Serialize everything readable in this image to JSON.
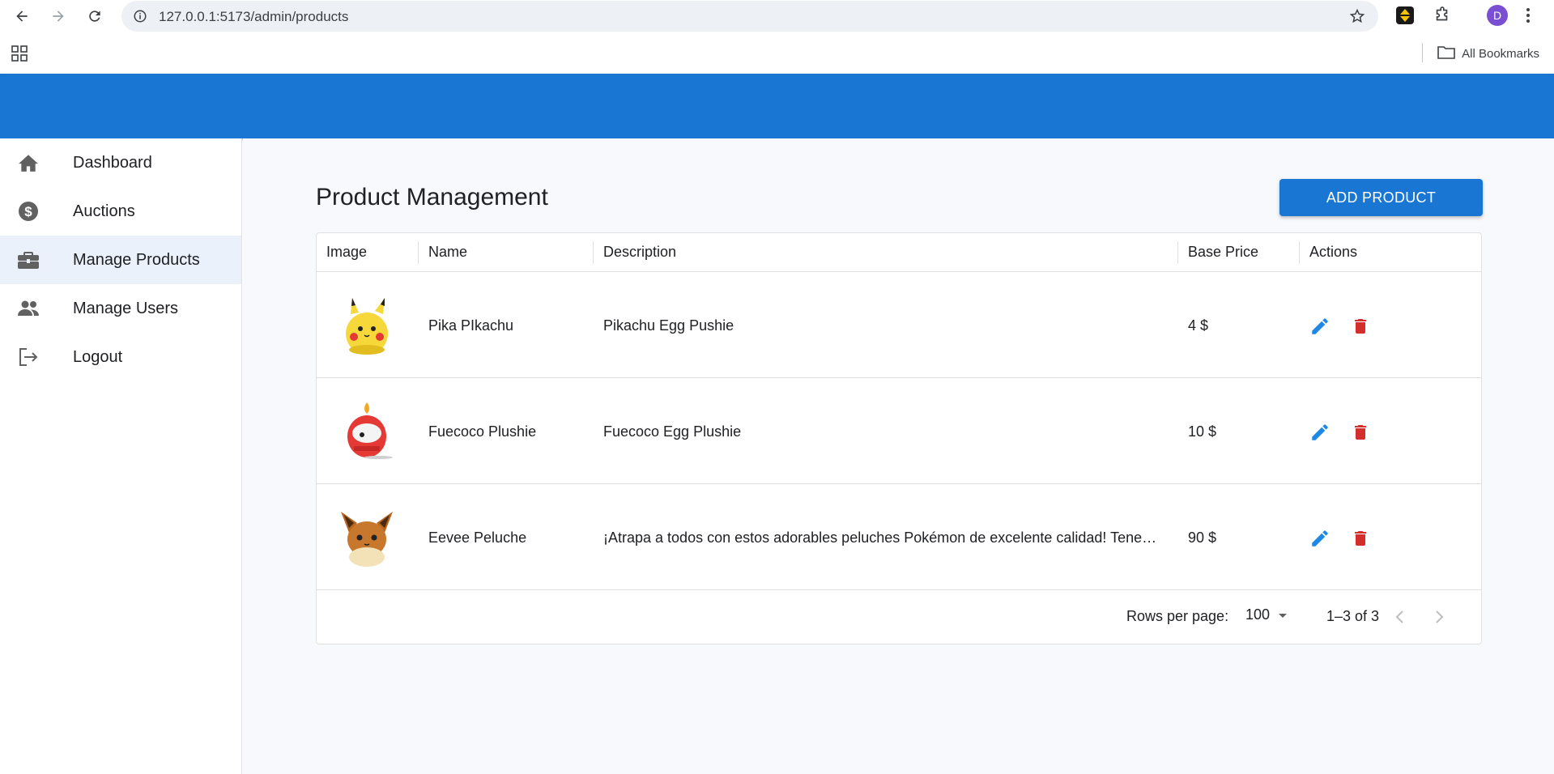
{
  "browser": {
    "url": "127.0.0.1:5173/admin/products",
    "bookmarks_label": "All Bookmarks",
    "profile_initial": "D",
    "icons": [
      "back-icon",
      "forward-icon",
      "reload-icon",
      "site-info-icon",
      "star-icon",
      "extension-icon",
      "puzzle-icon",
      "menu-icon",
      "apps-icon",
      "folder-icon"
    ]
  },
  "sidebar": {
    "items": [
      {
        "label": "Dashboard",
        "icon": "home-icon"
      },
      {
        "label": "Auctions",
        "icon": "dollar-icon"
      },
      {
        "label": "Manage Products",
        "icon": "briefcase-icon",
        "active": true
      },
      {
        "label": "Manage Users",
        "icon": "people-icon"
      },
      {
        "label": "Logout",
        "icon": "logout-icon"
      }
    ]
  },
  "main": {
    "title": "Product Management",
    "add_button": "ADD PRODUCT",
    "columns": [
      "Image",
      "Name",
      "Description",
      "Base Price",
      "Actions"
    ],
    "rows": [
      {
        "name": "Pika PIkachu",
        "description": "Pikachu Egg Pushie",
        "price": "4 $",
        "image": "pikachu-plush-image"
      },
      {
        "name": "Fuecoco Plushie",
        "description": "Fuecoco Egg Plushie",
        "price": "10 $",
        "image": "fuecoco-plush-image"
      },
      {
        "name": "Eevee Peluche",
        "description": "¡Atrapa a todos con estos adorables peluches Pokémon de excelente calidad! Tenemos muchos modelos disponibles",
        "price": "90 $",
        "image": "eevee-plush-image"
      }
    ],
    "pagination": {
      "rows_per_page_label": "Rows per page:",
      "rows_per_page_value": "100",
      "range": "1–3 of 3"
    }
  },
  "colors": {
    "primary": "#1976d2",
    "edit_icon": "#1e88e5",
    "delete_icon": "#d32f2f"
  }
}
